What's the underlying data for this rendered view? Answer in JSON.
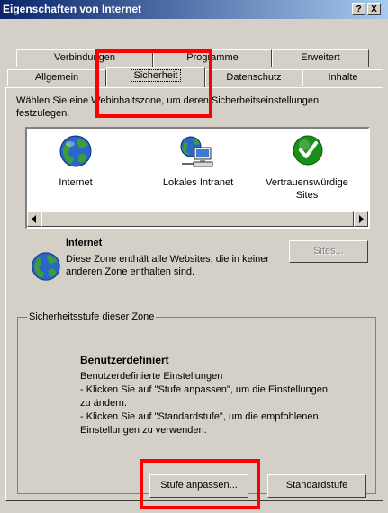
{
  "window": {
    "title": "Eigenschaften von Internet",
    "help_button": "?",
    "close_button": "X"
  },
  "tabs": {
    "row_back": [
      "Verbindungen",
      "Programme",
      "Erweitert"
    ],
    "row_front": [
      "Allgemein",
      "Sicherheit",
      "Datenschutz",
      "Inhalte"
    ],
    "active": "Sicherheit"
  },
  "security": {
    "instruction": "Wählen Sie eine Webinhaltszone, um deren Sicherheitseinstellungen festzulegen.",
    "instruction_line1": "Wählen Sie eine Webinhaltszone, um deren Sicherheitseinstellungen",
    "instruction_line2": "festzulegen.",
    "zones": [
      {
        "label": "Internet",
        "icon": "globe-icon"
      },
      {
        "label": "Lokales Intranet",
        "icon": "computer-network-icon"
      },
      {
        "label": "Vertrauenswürdige Sites",
        "label_line1": "Vertrauenswürdige",
        "label_line2": "Sites",
        "icon": "checkmark-icon"
      }
    ],
    "selected_zone": {
      "name": "Internet",
      "description_line1": "Diese Zone enthält alle Websites, die in keiner",
      "description_line2": "anderen Zone enthalten sind."
    },
    "sites_button": "Sites...",
    "level_group_label": "Sicherheitsstufe dieser Zone",
    "level": {
      "title": "Benutzerdefiniert",
      "lines": [
        "Benutzerdefinierte Einstellungen",
        "- Klicken Sie auf \"Stufe anpassen\", um die Einstellungen",
        "zu ändern.",
        "- Klicken Sie auf \"Standardstufe\", um die empfohlenen",
        "Einstellungen zu verwenden."
      ]
    },
    "custom_level_button": "Stufe anpassen...",
    "default_level_button": "Standardstufe"
  },
  "colors": {
    "title_gradient_start": "#0a246a",
    "title_gradient_end": "#a6caf0",
    "dialog_face": "#d4d0c8",
    "highlight_red": "#ff0000",
    "check_green": "#1a8f1a"
  }
}
